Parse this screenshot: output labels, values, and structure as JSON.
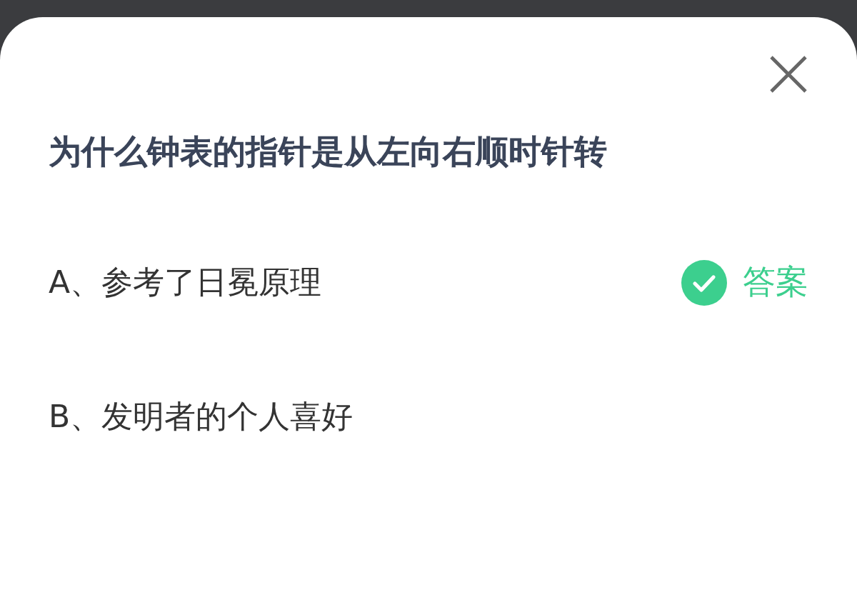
{
  "dialog": {
    "question": "为什么钟表的指针是从左向右顺时针转",
    "options": [
      {
        "label": "A、参考了日冕原理",
        "correct": true,
        "answer_label": "答案"
      },
      {
        "label": "B、发明者的个人喜好",
        "correct": false
      }
    ]
  }
}
